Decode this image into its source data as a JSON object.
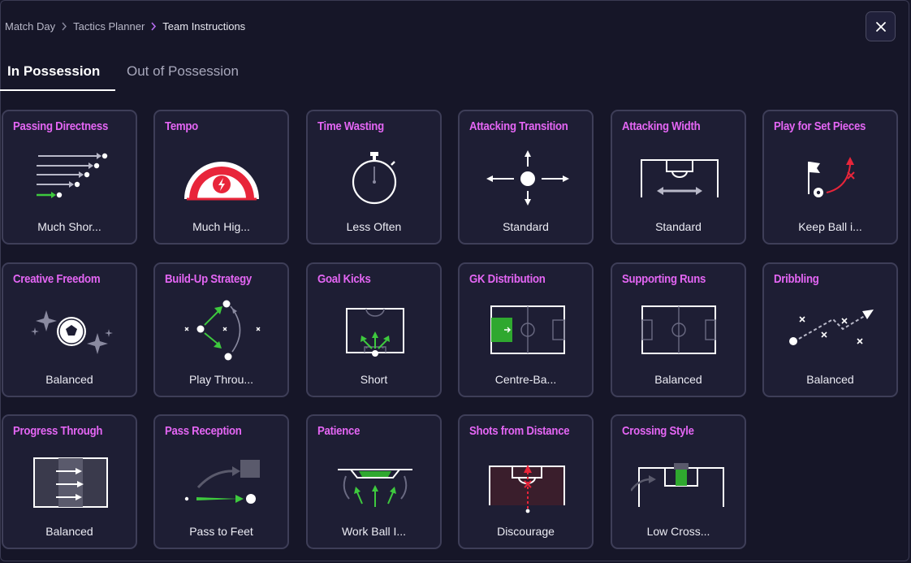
{
  "breadcrumb": [
    "Match Day",
    "Tactics Planner",
    "Team Instructions"
  ],
  "tabs": [
    {
      "label": "In Possession",
      "active": true
    },
    {
      "label": "Out of Possession",
      "active": false
    }
  ],
  "accent": "#e466f4",
  "instructions": [
    {
      "title": "Passing Directness",
      "value": "Much Shor...",
      "icon": "passing-directness-icon"
    },
    {
      "title": "Tempo",
      "value": "Much Hig...",
      "icon": "tempo-gauge-icon"
    },
    {
      "title": "Time Wasting",
      "value": "Less Often",
      "icon": "stopwatch-icon"
    },
    {
      "title": "Attacking Transition",
      "value": "Standard",
      "icon": "attacking-transition-icon"
    },
    {
      "title": "Attacking Width",
      "value": "Standard",
      "icon": "attacking-width-icon"
    },
    {
      "title": "Play for Set Pieces",
      "value": "Keep Ball i...",
      "icon": "set-pieces-icon"
    },
    {
      "title": "Creative Freedom",
      "value": "Balanced",
      "icon": "creative-freedom-icon"
    },
    {
      "title": "Build-Up Strategy",
      "value": "Play Throu...",
      "icon": "build-up-icon"
    },
    {
      "title": "Goal Kicks",
      "value": "Short",
      "icon": "goal-kicks-icon"
    },
    {
      "title": "GK Distribution",
      "value": "Centre-Ba...",
      "icon": "gk-distribution-icon"
    },
    {
      "title": "Supporting Runs",
      "value": "Balanced",
      "icon": "supporting-runs-icon"
    },
    {
      "title": "Dribbling",
      "value": "Balanced",
      "icon": "dribbling-icon"
    },
    {
      "title": "Progress Through",
      "value": "Balanced",
      "icon": "progress-through-icon"
    },
    {
      "title": "Pass Reception",
      "value": "Pass to Feet",
      "icon": "pass-reception-icon"
    },
    {
      "title": "Patience",
      "value": "Work Ball I...",
      "icon": "patience-icon"
    },
    {
      "title": "Shots from Distance",
      "value": "Discourage",
      "icon": "shots-distance-icon"
    },
    {
      "title": "Crossing Style",
      "value": "Low Cross...",
      "icon": "crossing-style-icon"
    }
  ]
}
